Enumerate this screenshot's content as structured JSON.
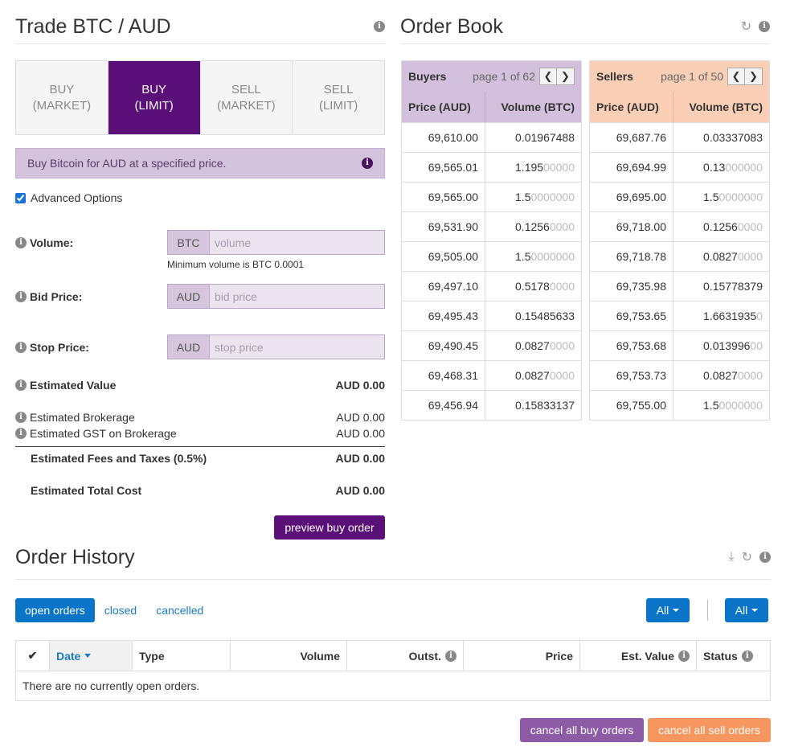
{
  "trade": {
    "title": "Trade BTC / AUD",
    "tabs": [
      {
        "line1": "BUY",
        "line2": "(MARKET)"
      },
      {
        "line1": "BUY",
        "line2": "(LIMIT)"
      },
      {
        "line1": "SELL",
        "line2": "(MARKET)"
      },
      {
        "line1": "SELL",
        "line2": "(LIMIT)"
      }
    ],
    "active_tab": "BUY (LIMIT)",
    "description": "Buy Bitcoin for AUD at a specified price.",
    "advanced_options": "Advanced Options",
    "volume": {
      "label": "Volume:",
      "addon": "BTC",
      "placeholder": "volume",
      "hint": "Minimum volume is BTC 0.0001"
    },
    "bid_price": {
      "label": "Bid Price:",
      "addon": "AUD",
      "placeholder": "bid price"
    },
    "stop_price": {
      "label": "Stop Price:",
      "addon": "AUD",
      "placeholder": "stop price"
    },
    "estimated_value": {
      "label": "Estimated Value",
      "value": "AUD 0.00"
    },
    "estimated_brokerage": {
      "label": "Estimated Brokerage",
      "value": "AUD 0.00"
    },
    "estimated_gst": {
      "label": "Estimated GST on Brokerage",
      "value": "AUD 0.00"
    },
    "estimated_fees": {
      "label": "Estimated Fees and Taxes (0.5%)",
      "value": "AUD 0.00"
    },
    "estimated_total": {
      "label": "Estimated Total Cost",
      "value": "AUD 0.00"
    },
    "preview_button": "preview buy order"
  },
  "order_book": {
    "title": "Order Book",
    "buyers": {
      "label": "Buyers",
      "page": "page 1 of 62",
      "col_price": "Price (AUD)",
      "col_volume": "Volume (BTC)",
      "rows": [
        {
          "price": "69,610.00",
          "vol": "0.01967488",
          "vol_dim": ""
        },
        {
          "price": "69,565.01",
          "vol": "1.195",
          "vol_dim": "00000"
        },
        {
          "price": "69,565.00",
          "vol": "1.5",
          "vol_dim": "0000000"
        },
        {
          "price": "69,531.90",
          "vol": "0.1256",
          "vol_dim": "0000"
        },
        {
          "price": "69,505.00",
          "vol": "1.5",
          "vol_dim": "0000000"
        },
        {
          "price": "69,497.10",
          "vol": "0.5178",
          "vol_dim": "0000"
        },
        {
          "price": "69,495.43",
          "vol": "0.15485633",
          "vol_dim": ""
        },
        {
          "price": "69,490.45",
          "vol": "0.0827",
          "vol_dim": "0000"
        },
        {
          "price": "69,468.31",
          "vol": "0.0827",
          "vol_dim": "0000"
        },
        {
          "price": "69,456.94",
          "vol": "0.15833137",
          "vol_dim": ""
        }
      ]
    },
    "sellers": {
      "label": "Sellers",
      "page": "page 1 of 50",
      "col_price": "Price (AUD)",
      "col_volume": "Volume (BTC)",
      "rows": [
        {
          "price": "69,687.76",
          "vol": "0.03337083",
          "vol_dim": ""
        },
        {
          "price": "69,694.99",
          "vol": "0.13",
          "vol_dim": "000000"
        },
        {
          "price": "69,695.00",
          "vol": "1.5",
          "vol_dim": "0000000"
        },
        {
          "price": "69,718.00",
          "vol": "0.1256",
          "vol_dim": "0000"
        },
        {
          "price": "69,718.78",
          "vol": "0.0827",
          "vol_dim": "0000"
        },
        {
          "price": "69,735.98",
          "vol": "0.15778379",
          "vol_dim": ""
        },
        {
          "price": "69,753.65",
          "vol": "1.6631935",
          "vol_dim": "0"
        },
        {
          "price": "69,753.68",
          "vol": "0.013996",
          "vol_dim": "00"
        },
        {
          "price": "69,753.73",
          "vol": "0.0827",
          "vol_dim": "0000"
        },
        {
          "price": "69,755.00",
          "vol": "1.5",
          "vol_dim": "0000000"
        }
      ]
    }
  },
  "history": {
    "title": "Order History",
    "tabs": [
      "open orders",
      "closed",
      "cancelled"
    ],
    "filter1": "All",
    "filter2": "All",
    "columns": [
      "Date",
      "Type",
      "Volume",
      "Outst.",
      "Price",
      "Est. Value",
      "Status"
    ],
    "empty_message": "There are no currently open orders.",
    "cancel_buy": "cancel all buy orders",
    "cancel_sell": "cancel all sell orders"
  },
  "colors": {
    "primary_purple": "#5b0f79",
    "blue": "#0a74c9",
    "buyers_bg": "#d3c0dc",
    "sellers_bg": "#fbcfb6",
    "sell_button": "#f7965e"
  }
}
